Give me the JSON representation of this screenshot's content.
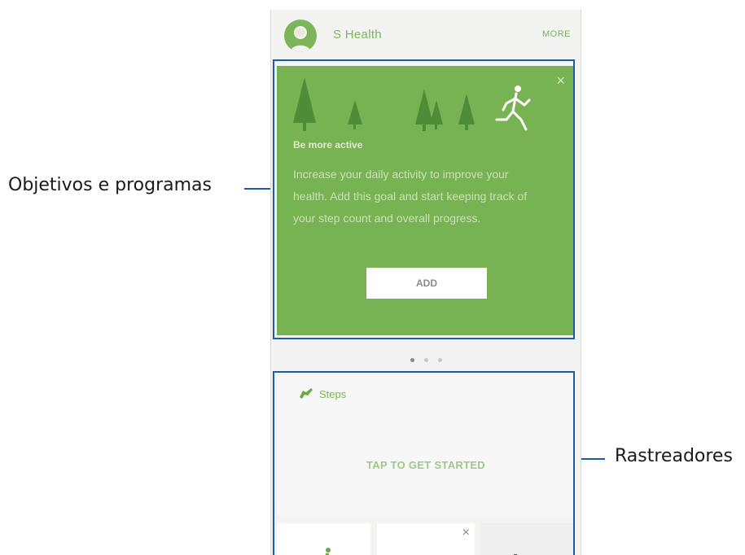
{
  "annotations": {
    "goals_label": "Objetivos e programas",
    "trackers_label": "Rastreadores"
  },
  "header": {
    "title": "S Health",
    "more_label": "MORE"
  },
  "goal_card": {
    "heading": "Be more active",
    "body": "Increase your daily activity to improve your health. Add this goal and start keeping track of your step count and overall progress.",
    "add_label": "ADD",
    "close_icon": "×",
    "page_count": 3,
    "active_page": 1
  },
  "tracker_card": {
    "title": "Steps",
    "cta": "TAP TO GET STARTED"
  },
  "tiles": {
    "tile2_close": "×"
  },
  "colors": {
    "accent_green": "#77b253",
    "highlight_blue": "#1f5aa8"
  }
}
